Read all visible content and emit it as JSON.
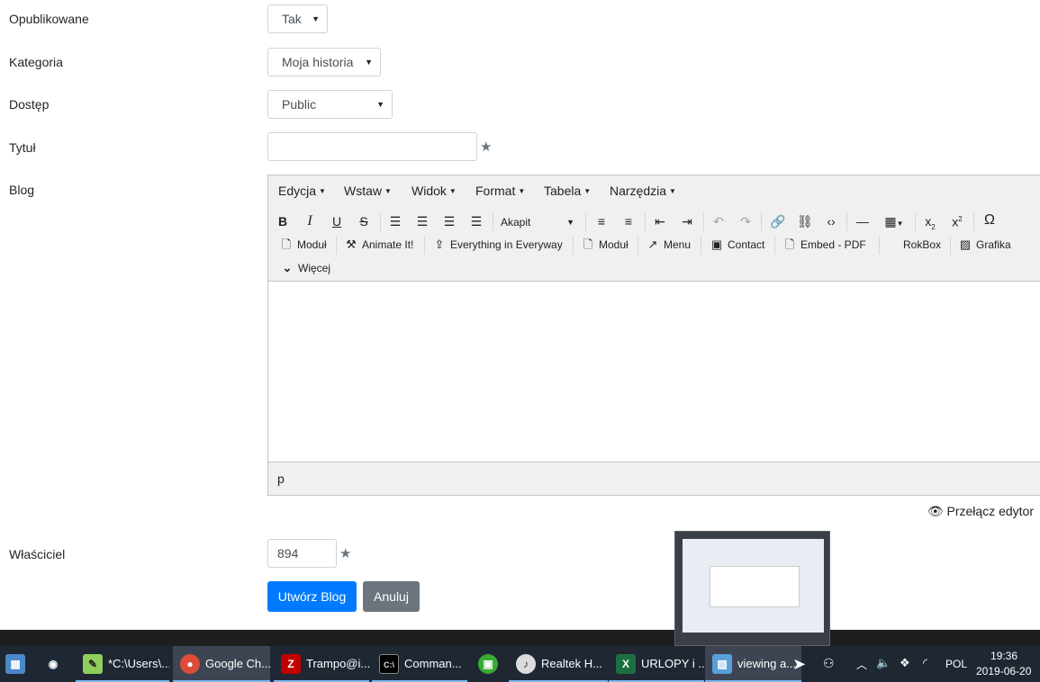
{
  "form": {
    "published": {
      "label": "Opublikowane",
      "value": "Tak"
    },
    "category": {
      "label": "Kategoria",
      "value": "Moja historia"
    },
    "access": {
      "label": "Dostęp",
      "value": "Public"
    },
    "title": {
      "label": "Tytuł",
      "value": ""
    },
    "blog": {
      "label": "Blog"
    },
    "owner": {
      "label": "Właściciel",
      "value": "894"
    }
  },
  "editor": {
    "menus": [
      "Edycja",
      "Wstaw",
      "Widok",
      "Format",
      "Tabela",
      "Narzędzia"
    ],
    "block_format": "Akapit",
    "plugins": {
      "modul1": "Moduł",
      "animate": "Animate It!",
      "everything": "Everything in Everyway",
      "modul2": "Moduł",
      "menu": "Menu",
      "contact": "Contact",
      "embed": "Embed - PDF",
      "rokbox": "RokBox",
      "grafika": "Grafika",
      "more": "Więcej"
    },
    "path": "p",
    "toggle_label": "Przełącz edytor"
  },
  "buttons": {
    "create": "Utwórz Blog",
    "cancel": "Anuluj"
  },
  "colors": {
    "primary": "#007bff",
    "secondary": "#6c757d"
  },
  "taskbar": {
    "items": [
      {
        "label": "*C:\\Users\\...",
        "icon": "notepad-plus-icon"
      },
      {
        "label": "Google Ch...",
        "icon": "chrome-icon"
      },
      {
        "label": "Trampo@i...",
        "icon": "filezilla-icon"
      },
      {
        "label": "Comman...",
        "icon": "cmd-icon"
      },
      {
        "label": "Realtek H...",
        "icon": "realtek-icon"
      },
      {
        "label": "URLOPY i ...",
        "icon": "excel-icon"
      },
      {
        "label": "viewing a...",
        "icon": "photos-icon"
      }
    ],
    "language": "POL",
    "time": "19:36",
    "date": "2019-06-20"
  }
}
